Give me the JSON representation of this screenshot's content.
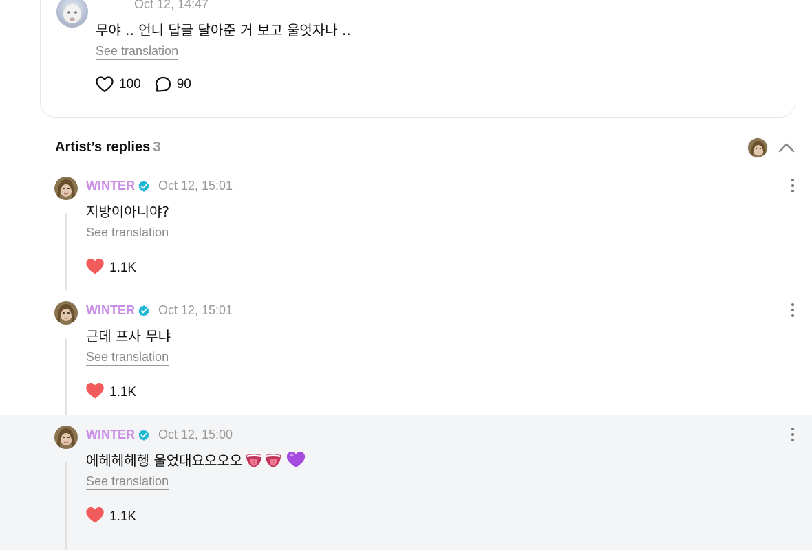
{
  "post": {
    "time": "Oct 12, 14:47",
    "text": "무야 .. 언니 답글 달아준 거 보고 울엇자나 ..",
    "see_translation": "See translation",
    "likes": "100",
    "comments": "90",
    "icons": [
      "heart-outline-icon",
      "comment-bubble-icon",
      "more-vertical-icon"
    ]
  },
  "replies_section": {
    "title": "Artist’s replies",
    "count": "3",
    "icons": [
      "artist-avatar",
      "chevron-up-icon"
    ]
  },
  "replies": [
    {
      "name": "WINTER",
      "time": "Oct 12, 15:01",
      "text": "지방이아니야?",
      "see_translation": "See translation",
      "likes": "1.1K"
    },
    {
      "name": "WINTER",
      "time": "Oct 12, 15:01",
      "text": "근데 프사 무냐",
      "see_translation": "See translation",
      "likes": "1.1K"
    },
    {
      "name": "WINTER",
      "time": "Oct 12, 15:00",
      "text": "에헤헤헤헹 울었대요오오오",
      "emojis": [
        "tongue-emoji",
        "tongue-emoji",
        "purple-heart-emoji"
      ],
      "see_translation": "See translation",
      "likes": "1.1K",
      "highlighted": true
    }
  ],
  "colors": {
    "artist_name": "#c98ee6",
    "verified_badge": "#1fb6d5",
    "like_filled": "#f25b5b",
    "highlight_bg": "#f4f5f7",
    "muted_text": "#9a9a9a"
  }
}
